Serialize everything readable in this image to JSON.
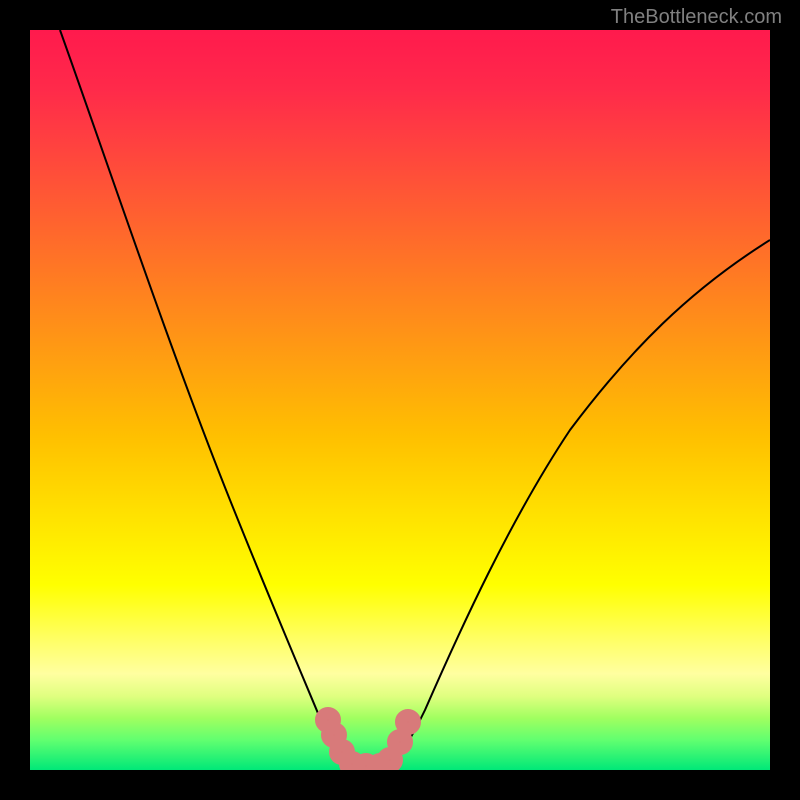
{
  "watermark": "TheBottleneck.com",
  "chart_data": {
    "type": "line",
    "title": "",
    "xlabel": "",
    "ylabel": "",
    "xlim": [
      0,
      100
    ],
    "ylim": [
      0,
      100
    ],
    "series": [
      {
        "name": "bottleneck-curve",
        "x": [
          4,
          8,
          12,
          16,
          20,
          24,
          28,
          32,
          36,
          38,
          40,
          42,
          44,
          46,
          48,
          52,
          56,
          60,
          64,
          68,
          72,
          76,
          80,
          84,
          88,
          92,
          96,
          100
        ],
        "values": [
          100,
          90,
          80,
          70,
          60,
          50,
          40,
          30,
          20,
          12,
          5,
          1,
          0,
          0,
          1,
          4,
          10,
          18,
          26,
          34,
          42,
          48,
          54,
          58,
          62,
          65,
          68,
          70
        ]
      }
    ],
    "markers": {
      "name": "highlighted-range",
      "color": "#d87a7a",
      "x": [
        38,
        39,
        40,
        41,
        42,
        43,
        44,
        45,
        46,
        47,
        48,
        49
      ],
      "values": [
        10,
        6,
        3,
        1,
        0,
        0,
        0,
        0,
        1,
        3,
        6,
        10
      ]
    },
    "gradient_stops": [
      {
        "pos": 0,
        "color": "#ff1a4d"
      },
      {
        "pos": 50,
        "color": "#ffc000"
      },
      {
        "pos": 80,
        "color": "#ffff60"
      },
      {
        "pos": 100,
        "color": "#00e878"
      }
    ]
  }
}
